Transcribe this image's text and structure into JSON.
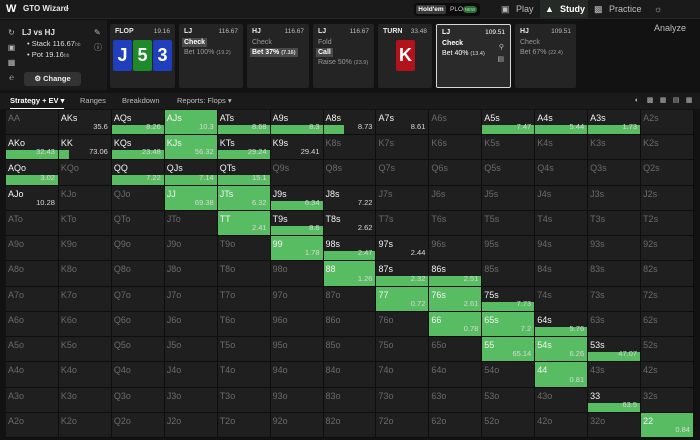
{
  "nav": {
    "app_name": "GTO Wizard",
    "mode_holdem": "Hold'em",
    "mode_plo": "PLO",
    "plo_badge": "NEW",
    "tabs": [
      {
        "label": "Play",
        "icon": "cards-icon"
      },
      {
        "label": "Study",
        "icon": "graduation-cap-icon"
      },
      {
        "label": "Practice",
        "icon": "gamepad-icon"
      },
      {
        "label": "Analyze",
        "icon": "lightbulb-icon"
      }
    ],
    "active_tab": "Study"
  },
  "spot": {
    "title": "LJ vs HJ",
    "stack_label": "Stack",
    "stack_value": "116.67",
    "stack_unit": "bb",
    "pot_label": "Pot",
    "pot_value": "19.16",
    "pot_unit": "bb",
    "change_label": "Change"
  },
  "action_cards": [
    {
      "pos": "FLOP",
      "stack": "19.16",
      "board": [
        {
          "rank": "J",
          "color": "#1f3fbf"
        },
        {
          "rank": "5",
          "color": "#1f8a2a"
        },
        {
          "rank": "3",
          "color": "#1f3fbf"
        }
      ]
    },
    {
      "pos": "LJ",
      "stack": "116.67",
      "options": [
        {
          "label": "Check",
          "freq": "",
          "selected": true
        },
        {
          "label": "Bet 100%",
          "freq": "(19.2)",
          "selected": false
        }
      ]
    },
    {
      "pos": "HJ",
      "stack": "116.67",
      "options": [
        {
          "label": "Check",
          "freq": "",
          "selected": false
        },
        {
          "label": "Bet 37%",
          "freq": "(7.16)",
          "selected": true
        }
      ]
    },
    {
      "pos": "LJ",
      "stack": "116.67",
      "options": [
        {
          "label": "Fold",
          "freq": "",
          "selected": false
        },
        {
          "label": "Call",
          "freq": "",
          "selected": true
        },
        {
          "label": "Raise 50%",
          "freq": "(23.9)",
          "selected": false
        }
      ]
    },
    {
      "pos": "TURN",
      "stack": "33.48",
      "board": [
        {
          "rank": "K",
          "color": "#b3121b"
        }
      ]
    },
    {
      "pos": "LJ",
      "stack": "109.51",
      "options": [
        {
          "label": "Check",
          "freq": "",
          "selected": true
        },
        {
          "label": "Bet 40%",
          "freq": "(13.4)",
          "selected": true
        }
      ]
    },
    {
      "pos": "HJ",
      "stack": "109.51",
      "options": [
        {
          "label": "Check",
          "freq": "",
          "selected": false
        },
        {
          "label": "Bet 67%",
          "freq": "(22.4)",
          "selected": false
        }
      ]
    }
  ],
  "filters": {
    "strategy": "Strategy + EV",
    "ranges": "Ranges",
    "breakdown": "Breakdown",
    "reports": "Reports: Flops"
  },
  "matrix_ranks": [
    "A",
    "K",
    "Q",
    "J",
    "T",
    "9",
    "8",
    "7",
    "6",
    "5",
    "4",
    "3",
    "2"
  ],
  "matrix": {
    "0,0": {
      "v": ""
    },
    "0,1": {
      "v": "35.6",
      "f": 0
    },
    "0,2": {
      "v": "8.26",
      "f": 1
    },
    "0,3": {
      "v": "10.3",
      "f": 1,
      "full": 1
    },
    "0,4": {
      "v": "8.68",
      "f": 1
    },
    "0,5": {
      "v": "8.3",
      "f": 1
    },
    "0,6": {
      "v": "8.73",
      "f": 0.4
    },
    "0,7": {
      "v": "8.61",
      "f": 0
    },
    "0,9": {
      "v": "7.47",
      "f": 1
    },
    "0,10": {
      "v": "5.44",
      "f": 1
    },
    "0,11": {
      "v": "1.73",
      "f": 1
    },
    "1,0": {
      "v": "32.43",
      "f": 1
    },
    "1,1": {
      "v": "73.06",
      "f": 0.2
    },
    "1,2": {
      "v": "23.48",
      "f": 1
    },
    "1,3": {
      "v": "56.32",
      "f": 1,
      "full": 1
    },
    "1,4": {
      "v": "29.24",
      "f": 1
    },
    "1,5": {
      "v": "29.41",
      "f": 0
    },
    "2,0": {
      "v": "3.02",
      "f": 1
    },
    "2,2": {
      "v": "7.22",
      "f": 1
    },
    "2,3": {
      "v": "7.14",
      "f": 1
    },
    "2,4": {
      "v": "15.1",
      "f": 1
    },
    "3,0": {
      "v": "10.28",
      "f": 0
    },
    "3,3": {
      "v": "69.38",
      "f": 1,
      "full": 1
    },
    "3,4": {
      "v": "6.32",
      "f": 1,
      "full": 1
    },
    "3,5": {
      "v": "6.34",
      "f": 1
    },
    "3,6": {
      "v": "7.22",
      "f": 0
    },
    "4,4": {
      "v": "2.41",
      "f": 1,
      "full": 1
    },
    "4,5": {
      "v": "8.6",
      "f": 1
    },
    "4,6": {
      "v": "2.62",
      "f": 0
    },
    "5,5": {
      "v": "1.78",
      "f": 1,
      "full": 1
    },
    "5,6": {
      "v": "2.47",
      "f": 1
    },
    "5,7": {
      "v": "2.44",
      "f": 0
    },
    "6,6": {
      "v": "1.26",
      "f": 1,
      "full": 1
    },
    "6,7": {
      "v": "2.32",
      "f": 1
    },
    "6,8": {
      "v": "2.51",
      "f": 1
    },
    "7,7": {
      "v": "0.72",
      "f": 1,
      "full": 1
    },
    "7,8": {
      "v": "2.61",
      "f": 1,
      "full": 1
    },
    "7,9": {
      "v": "7.73",
      "f": 1
    },
    "8,8": {
      "v": "0.78",
      "f": 1,
      "full": 1
    },
    "8,9": {
      "v": "7.2",
      "f": 1,
      "full": 1
    },
    "8,10": {
      "v": "5.76",
      "f": 1
    },
    "9,9": {
      "v": "65.14",
      "f": 1,
      "full": 1
    },
    "9,10": {
      "v": "6.26",
      "f": 1,
      "full": 1
    },
    "9,11": {
      "v": "47.07",
      "f": 1
    },
    "10,10": {
      "v": "0.81",
      "f": 1,
      "full": 1
    },
    "11,11": {
      "v": "63.5",
      "f": 1
    },
    "12,12": {
      "v": "0.84",
      "f": 1,
      "full": 1
    }
  },
  "live_hands": [
    "AKs",
    "AQs",
    "AJs",
    "ATs",
    "A9s",
    "A8s",
    "A7s",
    "A5s",
    "A4s",
    "A3s",
    "AKo",
    "KK",
    "KQs",
    "KJs",
    "KTs",
    "K9s",
    "AQo",
    "QQ",
    "QJs",
    "QTs",
    "AJo",
    "JJ",
    "JTs",
    "J9s",
    "J8s",
    "TT",
    "T9s",
    "T8s",
    "99",
    "98s",
    "97s",
    "88",
    "87s",
    "86s",
    "77",
    "76s",
    "75s",
    "66",
    "65s",
    "64s",
    "55",
    "54s",
    "53s",
    "44",
    "33",
    "22"
  ],
  "colors": {
    "accent": "#58bd62",
    "bg": "#121212"
  }
}
